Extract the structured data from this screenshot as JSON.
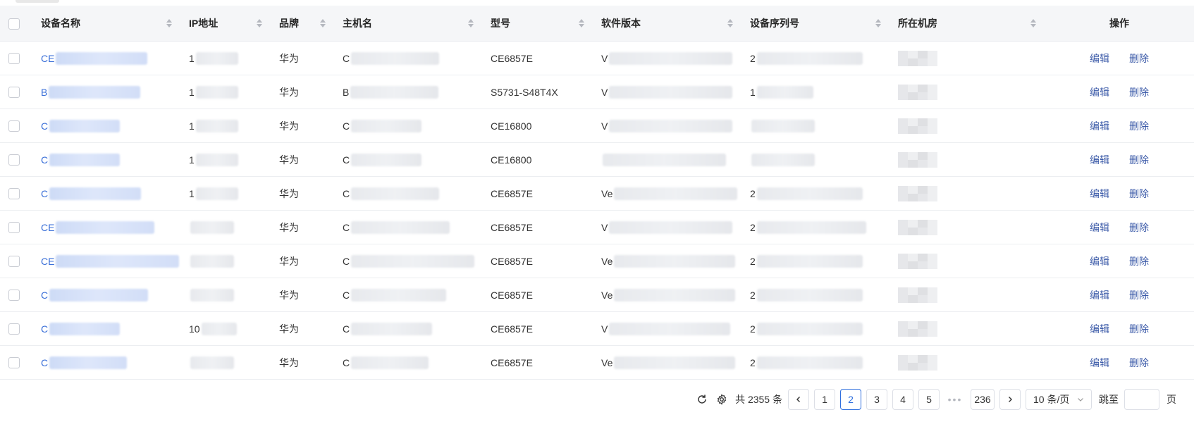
{
  "table": {
    "columns": [
      {
        "key": "name",
        "label": "设备名称",
        "sortable": true
      },
      {
        "key": "ip",
        "label": "IP地址",
        "sortable": true
      },
      {
        "key": "brand",
        "label": "品牌",
        "sortable": true
      },
      {
        "key": "host",
        "label": "主机名",
        "sortable": true
      },
      {
        "key": "model",
        "label": "型号",
        "sortable": true
      },
      {
        "key": "software",
        "label": "软件版本",
        "sortable": true
      },
      {
        "key": "serial",
        "label": "设备序列号",
        "sortable": true
      },
      {
        "key": "room",
        "label": "所在机房",
        "sortable": true
      },
      {
        "key": "op",
        "label": "操作",
        "sortable": false
      }
    ],
    "rows": [
      {
        "name": "CE",
        "ip": "1",
        "brand": "华为",
        "host": "C",
        "model": "CE6857E",
        "software": "V",
        "serial": "2"
      },
      {
        "name": "B",
        "ip": "1",
        "brand": "华为",
        "host": "B",
        "model": "S5731-S48T4X",
        "software": "V",
        "serial": "1"
      },
      {
        "name": "C",
        "ip": "1",
        "brand": "华为",
        "host": "C",
        "model": "CE16800",
        "software": "V",
        "serial": ""
      },
      {
        "name": "C",
        "ip": "1",
        "brand": "华为",
        "host": "C",
        "model": "CE16800",
        "software": "",
        "serial": ""
      },
      {
        "name": "C",
        "ip": "1",
        "brand": "华为",
        "host": "C",
        "model": "CE6857E",
        "software": "Ve",
        "serial": "2"
      },
      {
        "name": "CE",
        "ip": "",
        "brand": "华为",
        "host": "C",
        "model": "CE6857E",
        "software": "V",
        "serial": "2"
      },
      {
        "name": "CE",
        "ip": "",
        "brand": "华为",
        "host": "C",
        "model": "CE6857E",
        "software": "Ve",
        "serial": "2"
      },
      {
        "name": "C",
        "ip": "",
        "brand": "华为",
        "host": "C",
        "model": "CE6857E",
        "software": "Ve",
        "serial": "2"
      },
      {
        "name": "C",
        "ip": "10",
        "brand": "华为",
        "host": "C",
        "model": "CE6857E",
        "software": "V",
        "serial": "2"
      },
      {
        "name": "C",
        "ip": "",
        "brand": "华为",
        "host": "C",
        "model": "CE6857E",
        "software": "Ve",
        "serial": "2"
      }
    ],
    "actions": {
      "edit": "编辑",
      "delete": "删除"
    }
  },
  "pagination": {
    "total_text": "共 2355 条",
    "pages": [
      "1",
      "2",
      "3",
      "4",
      "5"
    ],
    "current_page": "2",
    "ellipsis": "•••",
    "last_page": "236",
    "page_size": "10 条/页",
    "jump_label": "跳至",
    "jump_suffix": "页",
    "jump_value": ""
  },
  "icons": {
    "refresh": "refresh-icon",
    "settings": "gear-icon",
    "prev": "chevron-left-icon",
    "next": "chevron-right-icon",
    "dropdown": "chevron-down-icon"
  },
  "colors": {
    "link": "#3a6fd8",
    "action_link": "#3b5aa8",
    "active_page": "#2f6fde",
    "header_bg": "#f5f6f8"
  }
}
